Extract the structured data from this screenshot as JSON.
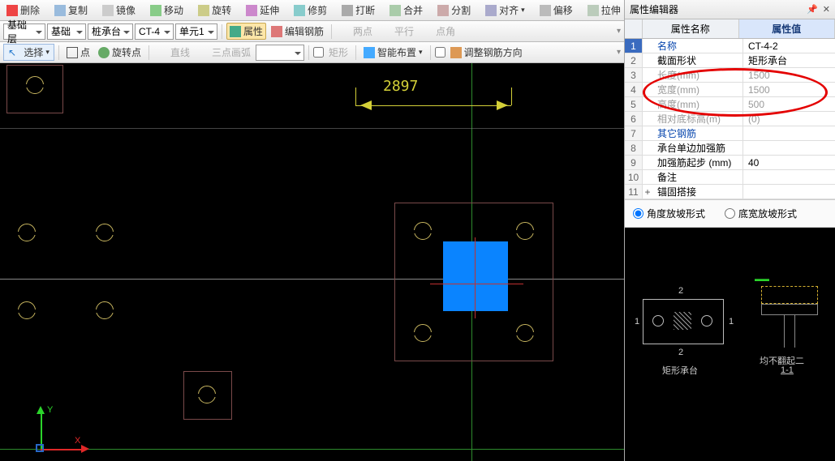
{
  "toolbar1": {
    "delete": "删除",
    "copy": "复制",
    "mirror": "镜像",
    "move": "移动",
    "rotate": "旋转",
    "extend": "延伸",
    "trim": "修剪",
    "break": "打断",
    "merge": "合并",
    "split": "分割",
    "align": "对齐",
    "offset": "偏移",
    "stretch": "拉伸"
  },
  "toolbar2": {
    "layer": "基础层",
    "cat": "基础",
    "type": "桩承台",
    "code": "CT-4",
    "unit": "单元1",
    "props": "属性",
    "editRebar": "编辑钢筋",
    "twopt": "两点",
    "parallel": "平行",
    "ptangle": "点角"
  },
  "toolbar3": {
    "select": "选择",
    "point": "点",
    "rotpoint": "旋转点",
    "line": "直线",
    "arc3": "三点画弧",
    "rect": "矩形",
    "smart": "智能布置",
    "adjust": "调整钢筋方向"
  },
  "dim": "2897",
  "propTitle": "属性编辑器",
  "propCols": {
    "name": "属性名称",
    "value": "属性值"
  },
  "props": [
    {
      "n": "名称",
      "v": "CT-4-2",
      "hl": true
    },
    {
      "n": "截面形状",
      "v": "矩形承台"
    },
    {
      "n": "长度(mm)",
      "v": "1500",
      "gray": true
    },
    {
      "n": "宽度(mm)",
      "v": "1500",
      "gray": true
    },
    {
      "n": "高度(mm)",
      "v": "500",
      "gray": true
    },
    {
      "n": "相对底标高(m)",
      "v": "(0)",
      "gray": true
    },
    {
      "n": "其它钢筋",
      "v": "",
      "link": true
    },
    {
      "n": "承台单边加强筋",
      "v": ""
    },
    {
      "n": "加强筋起步 (mm)",
      "v": "40"
    },
    {
      "n": "备注",
      "v": ""
    },
    {
      "n": "锚固搭接",
      "v": "",
      "plus": true
    }
  ],
  "radios": {
    "angle": "角度放坡形式",
    "width": "底宽放坡形式"
  },
  "preview": {
    "label1": "矩形承台",
    "label2": "均不翻起二",
    "label3": "1-1"
  }
}
